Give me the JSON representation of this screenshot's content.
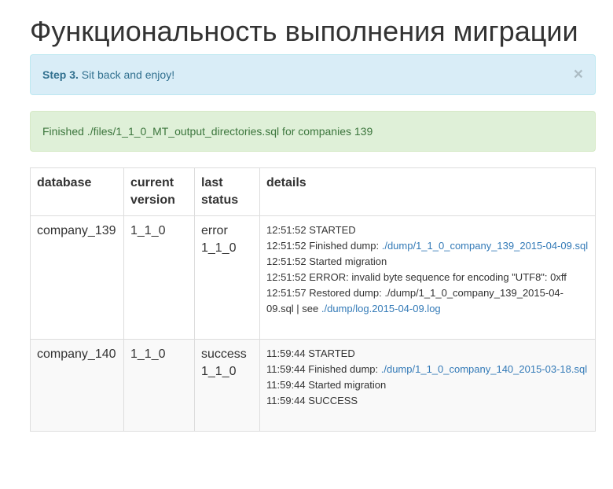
{
  "page": {
    "title": "Функциональность выполнения миграции"
  },
  "alert_info": {
    "step": "Step 3.",
    "message": " Sit back and enjoy!",
    "close": "×"
  },
  "alert_success": {
    "message": "Finished ./files/1_1_0_MT_output_directories.sql for companies 139"
  },
  "table": {
    "headers": {
      "database": "database",
      "current_version": "current version",
      "last_status": "last status",
      "details": "details"
    },
    "rows": [
      {
        "database": "company_139",
        "current_version": "1_1_0",
        "last_status": "error",
        "last_status_version": "1_1_0",
        "details": {
          "l1": "12:51:52 STARTED",
          "l2_text": "12:51:52 Finished dump: ",
          "l2_link": "./dump/1_1_0_company_139_2015-04-09.sql",
          "l3": "12:51:52 Started migration",
          "l4": "12:51:52 ERROR: invalid byte sequence for encoding \"UTF8\": 0xff",
          "l5_text": "12:51:57 Restored dump: ./dump/1_1_0_company_139_2015-04-09.sql | see ",
          "l5_link": "./dump/log.2015-04-09.log"
        }
      },
      {
        "database": "company_140",
        "current_version": "1_1_0",
        "last_status": "success",
        "last_status_version": "1_1_0",
        "details": {
          "l1": "11:59:44 STARTED",
          "l2_text": "11:59:44 Finished dump: ",
          "l2_link": "./dump/1_1_0_company_140_2015-03-18.sql",
          "l3": "11:59:44 Started migration",
          "l4": "11:59:44 SUCCESS"
        }
      }
    ]
  },
  "colors": {
    "info_bg": "#d9edf7",
    "info_text": "#31708f",
    "success_bg": "#dff0d8",
    "success_text": "#3c763d",
    "link": "#337ab7"
  }
}
